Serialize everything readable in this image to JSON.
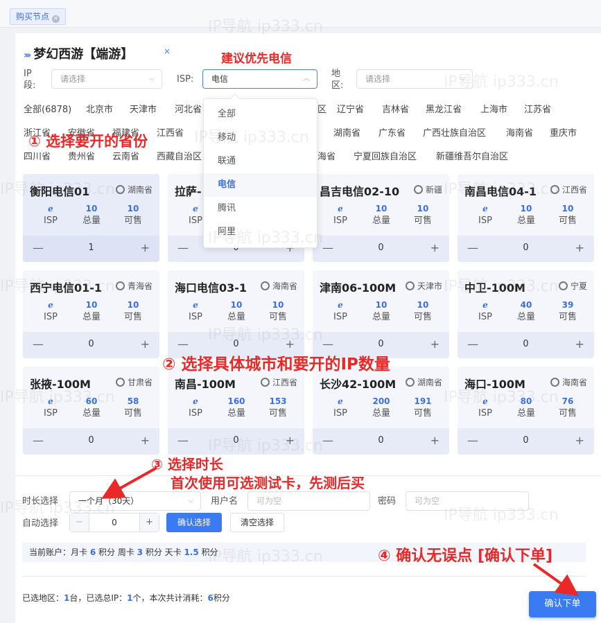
{
  "tab": {
    "label": "购买节点"
  },
  "page": {
    "title": "梦幻西游【端游】",
    "close": "×",
    "isp_hint": "建议优先电信"
  },
  "filters": {
    "ip_label": "IP\n段:",
    "ip_ph": "请选择",
    "isp_label": "ISP:",
    "isp_val": "电信",
    "region_label": "地\n区:",
    "region_ph": "请选择"
  },
  "provinces": {
    "row1": [
      "全部(6878)",
      "北京市",
      "天津市",
      "河北省",
      "区",
      "辽宁省",
      "吉林省",
      "黑龙江省",
      "上海市",
      "江苏省"
    ],
    "row2": [
      "浙江省",
      "安徽省",
      "福建省",
      "江西省",
      "湖南省",
      "广东省",
      "广西壮族自治区",
      "海南省",
      "重庆市"
    ],
    "row3": [
      "四川省",
      "贵州省",
      "云南省",
      "西藏自治区",
      "海省",
      "宁夏回族自治区",
      "新疆维吾尔自治区"
    ]
  },
  "isp_options": [
    "全部",
    "移动",
    "联通",
    "电信",
    "腾讯",
    "阿里"
  ],
  "annotations": {
    "step1": "① 选择要开的省份",
    "step2": "② 选择具体城市和要开的IP数量",
    "step3a": "③ 选择时长",
    "step3b": "首次使用可选测试卡，先测后买",
    "step4": "④ 确认无误点 [确认下单]"
  },
  "stat_labels": {
    "isp": "ISP",
    "total": "总量",
    "sale": "可售"
  },
  "cards": [
    {
      "name": "衡阳电信01",
      "loc": "湖南省",
      "total": "10",
      "sale": "10",
      "qty": "1"
    },
    {
      "name": "拉萨-",
      "loc": "",
      "total": "",
      "sale": "",
      "qty": "0"
    },
    {
      "name": "昌吉电信02-10",
      "loc": "新疆",
      "total": "10",
      "sale": "10",
      "qty": "0"
    },
    {
      "name": "南昌电信04-1",
      "loc": "江西省",
      "total": "10",
      "sale": "10",
      "qty": "0"
    },
    {
      "name": "西宁电信01-1",
      "loc": "青海省",
      "total": "10",
      "sale": "10",
      "qty": "0"
    },
    {
      "name": "海口电信03-1",
      "loc": "海南省",
      "total": "10",
      "sale": "10",
      "qty": "0"
    },
    {
      "name": "津南06-100M",
      "loc": "天津市",
      "total": "10",
      "sale": "10",
      "qty": "0"
    },
    {
      "name": "中卫-100M",
      "loc": "宁夏",
      "total": "40",
      "sale": "39",
      "qty": "0"
    },
    {
      "name": "张掖-100M",
      "loc": "甘肃省",
      "total": "60",
      "sale": "58",
      "qty": "0"
    },
    {
      "name": "南昌-100M",
      "loc": "江西省",
      "total": "160",
      "sale": "153",
      "qty": "0"
    },
    {
      "name": "长沙42-100M",
      "loc": "湖南省",
      "total": "200",
      "sale": "191",
      "qty": "0"
    },
    {
      "name": "海口-100M",
      "loc": "海南省",
      "total": "80",
      "sale": "76",
      "qty": "0"
    }
  ],
  "form": {
    "duration_label": "时长选择",
    "duration_val": "一个月（30天）",
    "user_label": "用户名",
    "user_ph": "可为空",
    "pwd_label": "密码",
    "pwd_ph": "可为空",
    "auto_label": "自动选择",
    "auto_val": "0",
    "confirm_sel": "确认选择",
    "clear_sel": "清空选择"
  },
  "account": {
    "prefix": "当前账户：月卡 ",
    "month": "6",
    "t1": " 积分 周卡 ",
    "week": "3",
    "t2": " 积分 天卡 ",
    "day": "1.5",
    "t3": " 积分"
  },
  "summary": {
    "a": "已选地区：",
    "regions": "1",
    "b": "台，已选总IP：",
    "ips": "1",
    "c": "个，本次共计消耗：",
    "cost": "6",
    "d": "积分"
  },
  "order_btn": "确认下单",
  "watermark": "IP导航  ip333.cn",
  "colors": {
    "accent": "#3a7af2",
    "annotation": "#ea2828"
  }
}
